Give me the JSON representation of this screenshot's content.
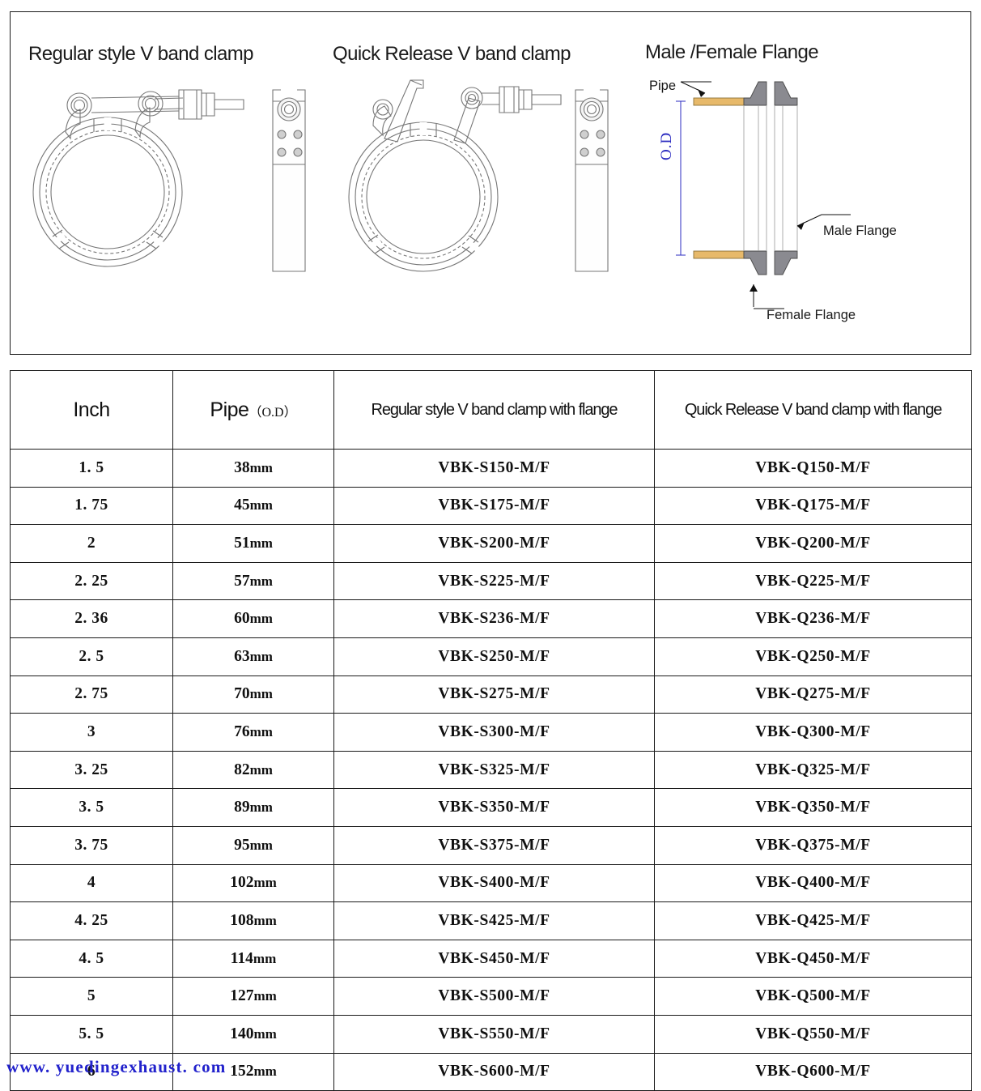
{
  "diagrams": {
    "regular_title": "Regular style V band clamp",
    "quick_title": "Quick Release V band clamp",
    "flange_title": "Male /Female Flange",
    "labels": {
      "pipe": "Pipe",
      "od": "O.D",
      "male_flange": "Male Flange",
      "female_flange": "Female Flange"
    },
    "colors": {
      "pipe": "#e7b96a",
      "flange": "#808085",
      "dimension": "#2b2bc0",
      "outline": "#666666",
      "border": "#1a1a1a"
    }
  },
  "table": {
    "headers": {
      "inch": "Inch",
      "pipe_main": "Pipe",
      "pipe_sub": "（O.D）",
      "regular": "Regular style V band clamp with flange",
      "quick": "Quick Release V band clamp with flange"
    },
    "rows": [
      {
        "inch": "1. 5",
        "pipe": "38",
        "unit": "mm",
        "regular": "VBK-S150-M/F",
        "quick": "VBK-Q150-M/F"
      },
      {
        "inch": "1. 75",
        "pipe": "45",
        "unit": "mm",
        "regular": "VBK-S175-M/F",
        "quick": "VBK-Q175-M/F"
      },
      {
        "inch": "2",
        "pipe": "51",
        "unit": "mm",
        "regular": "VBK-S200-M/F",
        "quick": "VBK-Q200-M/F"
      },
      {
        "inch": "2. 25",
        "pipe": "57",
        "unit": "mm",
        "regular": "VBK-S225-M/F",
        "quick": "VBK-Q225-M/F"
      },
      {
        "inch": "2. 36",
        "pipe": "60",
        "unit": "mm",
        "regular": "VBK-S236-M/F",
        "quick": "VBK-Q236-M/F"
      },
      {
        "inch": "2. 5",
        "pipe": "63",
        "unit": "mm",
        "regular": "VBK-S250-M/F",
        "quick": "VBK-Q250-M/F"
      },
      {
        "inch": "2. 75",
        "pipe": "70",
        "unit": "mm",
        "regular": "VBK-S275-M/F",
        "quick": "VBK-Q275-M/F"
      },
      {
        "inch": "3",
        "pipe": "76",
        "unit": "mm",
        "regular": "VBK-S300-M/F",
        "quick": "VBK-Q300-M/F"
      },
      {
        "inch": "3. 25",
        "pipe": "82",
        "unit": "mm",
        "regular": "VBK-S325-M/F",
        "quick": "VBK-Q325-M/F"
      },
      {
        "inch": "3. 5",
        "pipe": "89",
        "unit": "mm",
        "regular": "VBK-S350-M/F",
        "quick": "VBK-Q350-M/F"
      },
      {
        "inch": "3. 75",
        "pipe": "95",
        "unit": "mm",
        "regular": "VBK-S375-M/F",
        "quick": "VBK-Q375-M/F"
      },
      {
        "inch": "4",
        "pipe": "102",
        "unit": "mm",
        "regular": "VBK-S400-M/F",
        "quick": "VBK-Q400-M/F"
      },
      {
        "inch": "4. 25",
        "pipe": "108",
        "unit": "mm",
        "regular": "VBK-S425-M/F",
        "quick": "VBK-Q425-M/F"
      },
      {
        "inch": "4. 5",
        "pipe": "114",
        "unit": "mm",
        "regular": "VBK-S450-M/F",
        "quick": "VBK-Q450-M/F"
      },
      {
        "inch": "5",
        "pipe": "127",
        "unit": "mm",
        "regular": "VBK-S500-M/F",
        "quick": "VBK-Q500-M/F"
      },
      {
        "inch": "5. 5",
        "pipe": "140",
        "unit": "mm",
        "regular": "VBK-S550-M/F",
        "quick": "VBK-Q550-M/F"
      },
      {
        "inch": "6",
        "pipe": "152",
        "unit": "mm",
        "regular": "VBK-S600-M/F",
        "quick": "VBK-Q600-M/F"
      }
    ]
  },
  "watermark": "www. yuedingexhaust. com"
}
